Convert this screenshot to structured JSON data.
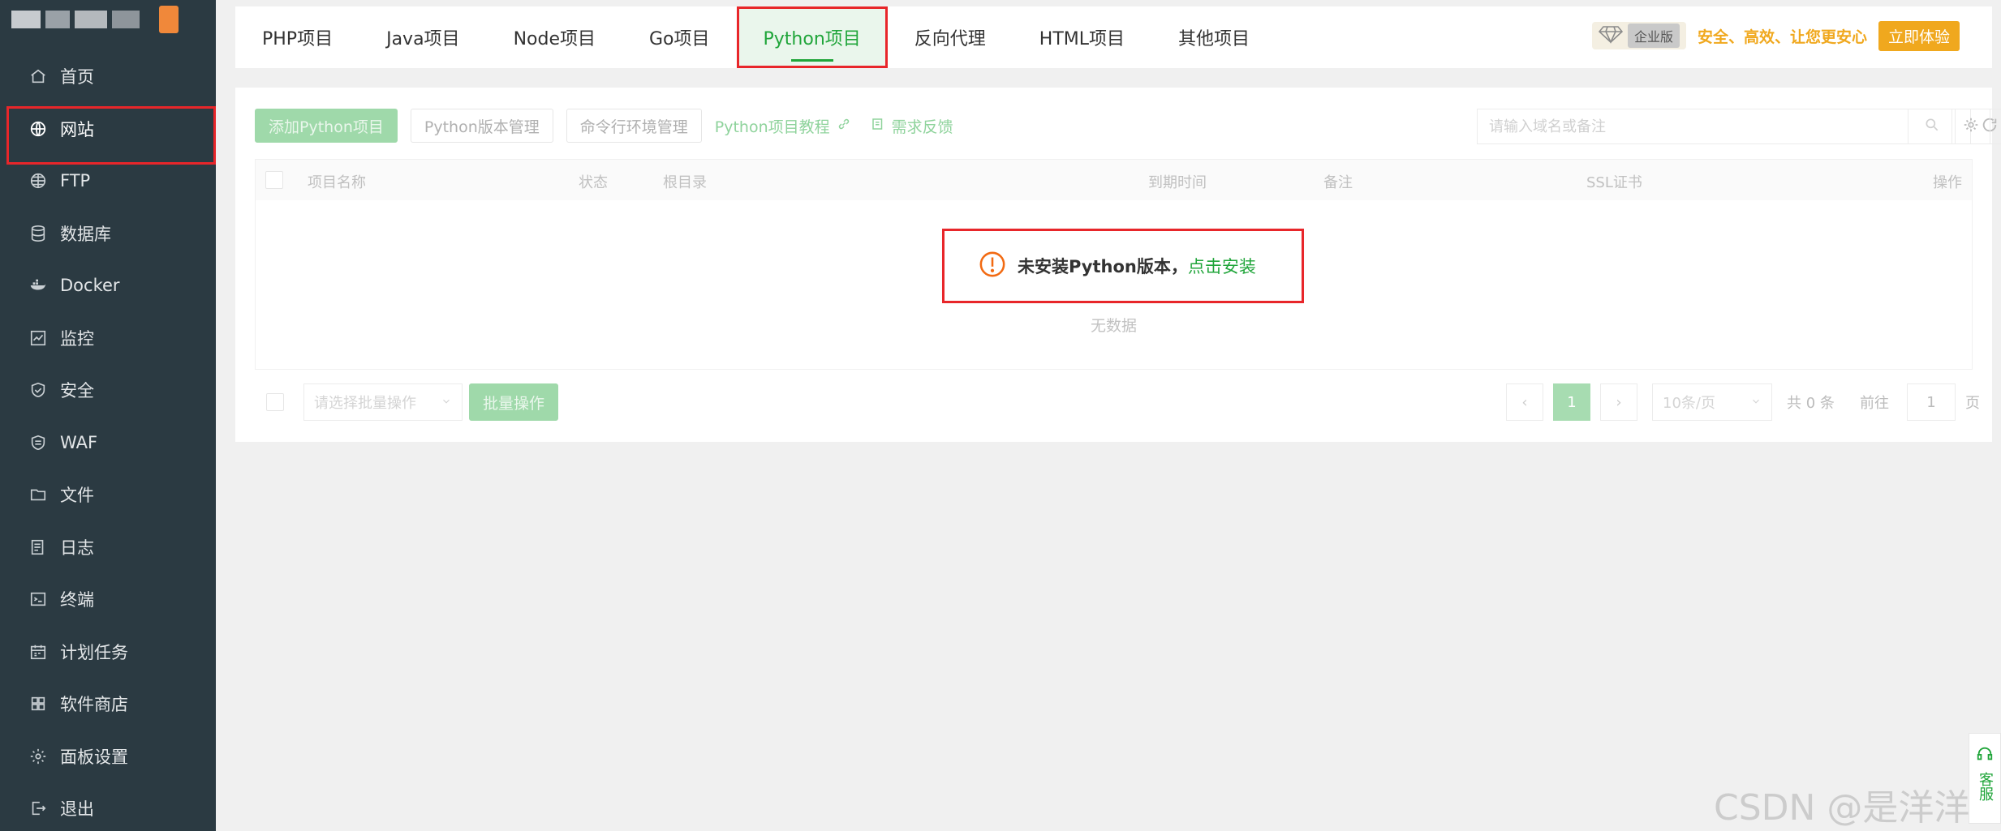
{
  "sidebar": {
    "items": [
      {
        "label": "首页",
        "icon": "home-icon"
      },
      {
        "label": "网站",
        "icon": "globe-icon"
      },
      {
        "label": "FTP",
        "icon": "ftp-globe-icon"
      },
      {
        "label": "数据库",
        "icon": "database-icon"
      },
      {
        "label": "Docker",
        "icon": "docker-icon"
      },
      {
        "label": "监控",
        "icon": "monitor-icon"
      },
      {
        "label": "安全",
        "icon": "shield-icon"
      },
      {
        "label": "WAF",
        "icon": "waf-shield-icon"
      },
      {
        "label": "文件",
        "icon": "folder-icon"
      },
      {
        "label": "日志",
        "icon": "log-icon"
      },
      {
        "label": "终端",
        "icon": "terminal-icon"
      },
      {
        "label": "计划任务",
        "icon": "calendar-icon"
      },
      {
        "label": "软件商店",
        "icon": "apps-icon"
      },
      {
        "label": "面板设置",
        "icon": "gear-icon"
      },
      {
        "label": "退出",
        "icon": "logout-icon"
      }
    ]
  },
  "tabs": [
    {
      "label": "PHP项目"
    },
    {
      "label": "Java项目"
    },
    {
      "label": "Node项目"
    },
    {
      "label": "Go项目"
    },
    {
      "label": "Python项目"
    },
    {
      "label": "反向代理"
    },
    {
      "label": "HTML项目"
    },
    {
      "label": "其他项目"
    }
  ],
  "promo": {
    "badge": "企业版",
    "text": "安全、高效、让您更安心",
    "button": "立即体验"
  },
  "toolbar": {
    "add_button": "添加Python项目",
    "version_button": "Python版本管理",
    "env_button": "命令行环境管理",
    "tutorial_link": "Python项目教程",
    "feedback_link": "需求反馈",
    "search_placeholder": "请输入域名或备注"
  },
  "table": {
    "columns": {
      "name": "项目名称",
      "status": "状态",
      "root": "根目录",
      "expire": "到期时间",
      "remark": "备注",
      "ssl": "SSL证书",
      "action": "操作"
    },
    "empty": "无数据"
  },
  "alert": {
    "message": "未安装Python版本，",
    "link": "点击安装"
  },
  "footer": {
    "batch_placeholder": "请选择批量操作",
    "batch_button": "批量操作",
    "current_page": "1",
    "page_size": "10条/页",
    "total": "共 0 条",
    "goto_label": "前往",
    "goto_value": "1",
    "page_unit": "页"
  },
  "float": {
    "label": "客服"
  },
  "watermark": "CSDN @是洋洋",
  "colors": {
    "sidebar_bg": "#2b3a42",
    "accent_green": "#20a53a",
    "highlight_red": "#e8262a",
    "promo_gold": "#f0a81e"
  }
}
